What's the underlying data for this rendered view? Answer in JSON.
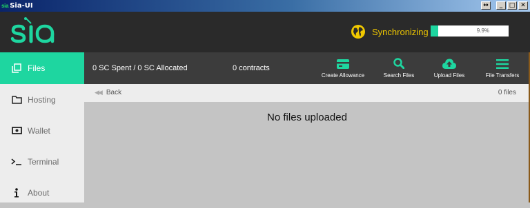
{
  "window": {
    "icon_text": "sia",
    "title": "Sia-UI",
    "buttons": [
      "↔",
      "_",
      "□",
      "✕"
    ]
  },
  "header": {
    "logo_text": "sia",
    "sync_status": "Synchronizing",
    "sync_progress_label": "9.9%",
    "sync_progress": 0.099
  },
  "sidebar": {
    "items": [
      {
        "label": "Files",
        "icon": "files-icon",
        "active": true
      },
      {
        "label": "Hosting",
        "icon": "folder-icon",
        "active": false
      },
      {
        "label": "Wallet",
        "icon": "wallet-icon",
        "active": false
      },
      {
        "label": "Terminal",
        "icon": "terminal-icon",
        "active": false
      },
      {
        "label": "About",
        "icon": "info-icon",
        "active": false
      }
    ]
  },
  "toolbar": {
    "spending": "0 SC Spent / 0 SC Allocated",
    "contracts": "0 contracts",
    "buttons": [
      {
        "label": "Create Allowance",
        "icon": "credit-card-icon"
      },
      {
        "label": "Search Files",
        "icon": "search-icon"
      },
      {
        "label": "Upload Files",
        "icon": "cloud-upload-icon"
      },
      {
        "label": "File Transfers",
        "icon": "menu-icon"
      }
    ]
  },
  "breadcrumb": {
    "back_label": "Back",
    "file_count": "0 files"
  },
  "main": {
    "empty_message": "No files uploaded"
  },
  "colors": {
    "accent": "#1ed6a0",
    "sync_text": "#f0c800",
    "header_bg": "#2a2a2a",
    "toolbar_bg": "#3c3c3c"
  }
}
